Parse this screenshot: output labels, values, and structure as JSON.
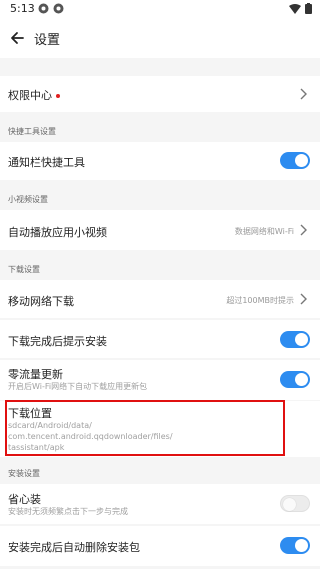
{
  "status_bar": {
    "time": "5:13"
  },
  "header": {
    "title": "设置"
  },
  "rows": {
    "permission_center": {
      "label": "权限中心"
    },
    "section_shortcut": {
      "text": "快捷工具设置"
    },
    "notification_shortcut": {
      "label": "通知栏快捷工具",
      "toggle": "on"
    },
    "section_video": {
      "text": "小视频设置"
    },
    "autoplay_video": {
      "label": "自动播放应用小视频",
      "value": "数据网络和Wi-Fi"
    },
    "section_download": {
      "text": "下载设置"
    },
    "mobile_download": {
      "label": "移动网络下载",
      "value": "超过100MB时提示"
    },
    "install_prompt": {
      "label": "下载完成后提示安装",
      "toggle": "on"
    },
    "zero_traffic": {
      "label": "零流量更新",
      "sub": "开启后Wi-Fi网络下自动下载应用更新包",
      "toggle": "on"
    },
    "download_location": {
      "label": "下载位置",
      "path_line1": "sdcard/Android/data/",
      "path_line2": "com.tencent.android.qqdownloader/files/",
      "path_line3": "tassistant/apk"
    },
    "section_install": {
      "text": "安装设置"
    },
    "easy_install": {
      "label": "省心装",
      "sub": "安装时无须频繁点击下一步与完成",
      "toggle": "off"
    },
    "auto_delete": {
      "label": "安装完成后自动删除安装包",
      "toggle": "on"
    }
  },
  "colors": {
    "accent": "#2d8cf0",
    "highlight": "#e01010",
    "badge": "#e02020"
  }
}
